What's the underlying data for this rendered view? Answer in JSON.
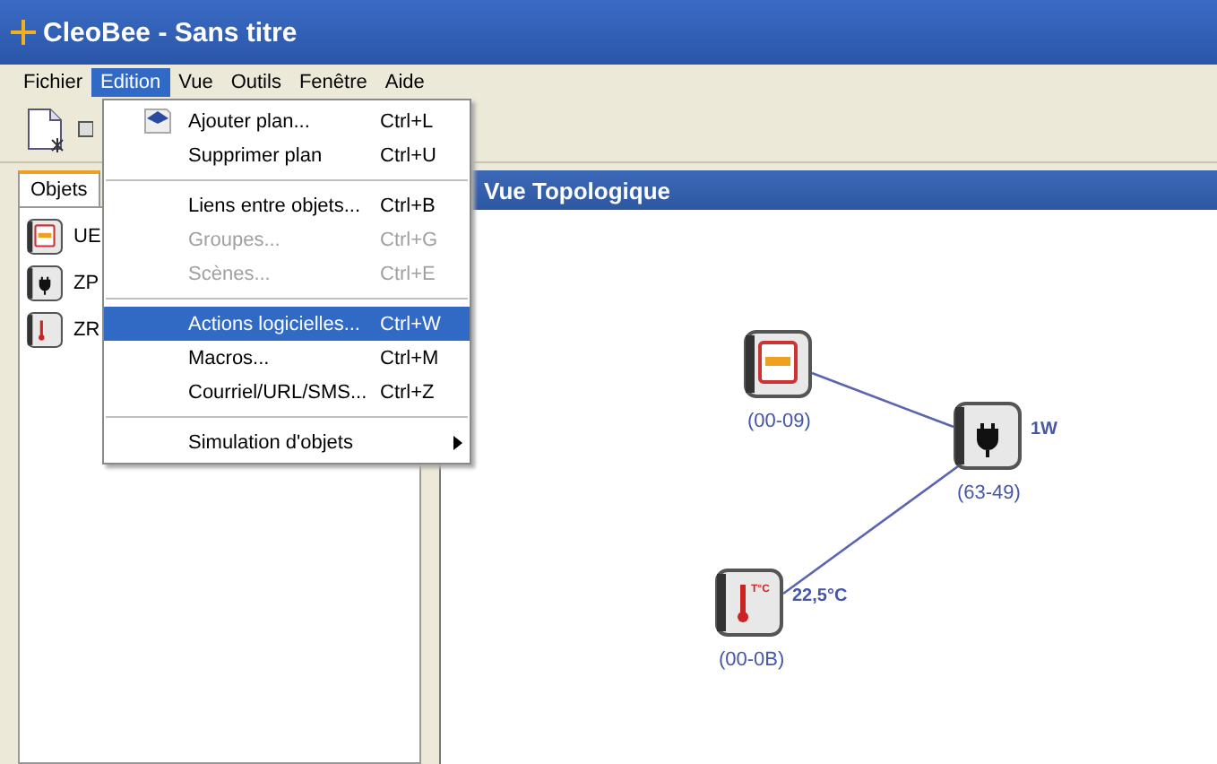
{
  "window": {
    "title": "CleoBee - Sans titre"
  },
  "menubar": [
    {
      "label": "Fichier",
      "selected": false
    },
    {
      "label": "Edition",
      "selected": true
    },
    {
      "label": "Vue",
      "selected": false
    },
    {
      "label": "Outils",
      "selected": false
    },
    {
      "label": "Fenêtre",
      "selected": false
    },
    {
      "label": "Aide",
      "selected": false
    }
  ],
  "sidebar": {
    "tab": {
      "label": "Objets",
      "selected": true
    },
    "items": [
      {
        "label": "UE",
        "kind": "switch"
      },
      {
        "label": "ZP",
        "kind": "plug"
      },
      {
        "label": "ZR",
        "kind": "thermo"
      }
    ]
  },
  "menu": [
    {
      "kind": "item",
      "label": "Ajouter plan...",
      "shortcut": "Ctrl+L",
      "icon": true,
      "disabled": false,
      "selected": false,
      "submenu": false
    },
    {
      "kind": "item",
      "label": "Supprimer plan",
      "shortcut": "Ctrl+U",
      "icon": false,
      "disabled": false,
      "selected": false,
      "submenu": false
    },
    {
      "kind": "separator"
    },
    {
      "kind": "item",
      "label": "Liens entre objets...",
      "shortcut": "Ctrl+B",
      "icon": false,
      "disabled": false,
      "selected": false,
      "submenu": false
    },
    {
      "kind": "item",
      "label": "Groupes...",
      "shortcut": "Ctrl+G",
      "icon": false,
      "disabled": true,
      "selected": false,
      "submenu": false
    },
    {
      "kind": "item",
      "label": "Scènes...",
      "shortcut": "Ctrl+E",
      "icon": false,
      "disabled": true,
      "selected": false,
      "submenu": false
    },
    {
      "kind": "separator"
    },
    {
      "kind": "item",
      "label": "Actions logicielles...",
      "shortcut": "Ctrl+W",
      "icon": false,
      "disabled": false,
      "selected": true,
      "submenu": false
    },
    {
      "kind": "item",
      "label": "Macros...",
      "shortcut": "Ctrl+M",
      "icon": false,
      "disabled": false,
      "selected": false,
      "submenu": false
    },
    {
      "kind": "item",
      "label": "Courriel/URL/SMS...",
      "shortcut": "Ctrl+Z",
      "icon": false,
      "disabled": false,
      "selected": false,
      "submenu": false
    },
    {
      "kind": "separator"
    },
    {
      "kind": "item",
      "label": "Simulation d'objets",
      "icon": false,
      "disabled": false,
      "selected": false,
      "submenu": true
    }
  ],
  "topology": {
    "title": "Vue Topologique",
    "nodes": [
      {
        "kind": "switch",
        "address": "(00-09)"
      },
      {
        "kind": "plug",
        "address": "(63-49)",
        "reading": "1W"
      },
      {
        "kind": "thermo",
        "address": "(00-0B)",
        "reading": "22,5°C",
        "icon_text": "T°C"
      }
    ]
  }
}
